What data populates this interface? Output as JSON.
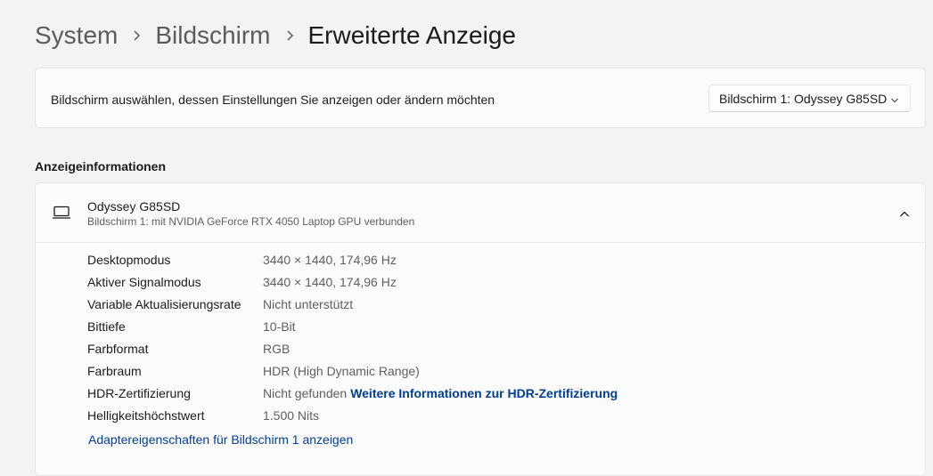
{
  "breadcrumb": {
    "items": [
      "System",
      "Bildschirm",
      "Erweiterte Anzeige"
    ]
  },
  "selector": {
    "label": "Bildschirm auswählen, dessen Einstellungen Sie anzeigen oder ändern möchten",
    "selected": "Bildschirm 1: Odyssey G85SD"
  },
  "display_info": {
    "section_title": "Anzeigeinformationen",
    "monitor_name": "Odyssey G85SD",
    "monitor_subtitle": "Bildschirm 1: mit NVIDIA GeForce RTX 4050 Laptop GPU verbunden",
    "rows": [
      {
        "label": "Desktopmodus",
        "value": "3440 × 1440, 174,96 Hz"
      },
      {
        "label": "Aktiver Signalmodus",
        "value": "3440 × 1440, 174,96 Hz"
      },
      {
        "label": "Variable Aktualisierungsrate",
        "value": "Nicht unterstützt"
      },
      {
        "label": "Bittiefe",
        "value": "10-Bit"
      },
      {
        "label": "Farbformat",
        "value": "RGB"
      },
      {
        "label": "Farbraum",
        "value": "HDR (High Dynamic Range)"
      },
      {
        "label": "HDR-Zertifizierung",
        "value": "Nicht gefunden",
        "link": "Weitere Informationen zur HDR-Zertifizierung"
      },
      {
        "label": "Helligkeitshöchstwert",
        "value": "1.500 Nits"
      }
    ],
    "adapter_link": "Adaptereigenschaften für Bildschirm 1 anzeigen"
  },
  "icons": {
    "breadcrumb_separator": "chevron-right-icon",
    "dropdown": "chevron-down-icon",
    "monitor": "laptop-icon",
    "collapse": "chevron-up-icon"
  },
  "colors": {
    "background": "#f3f3f3",
    "card": "#fbfbfb",
    "link": "#003e92"
  }
}
